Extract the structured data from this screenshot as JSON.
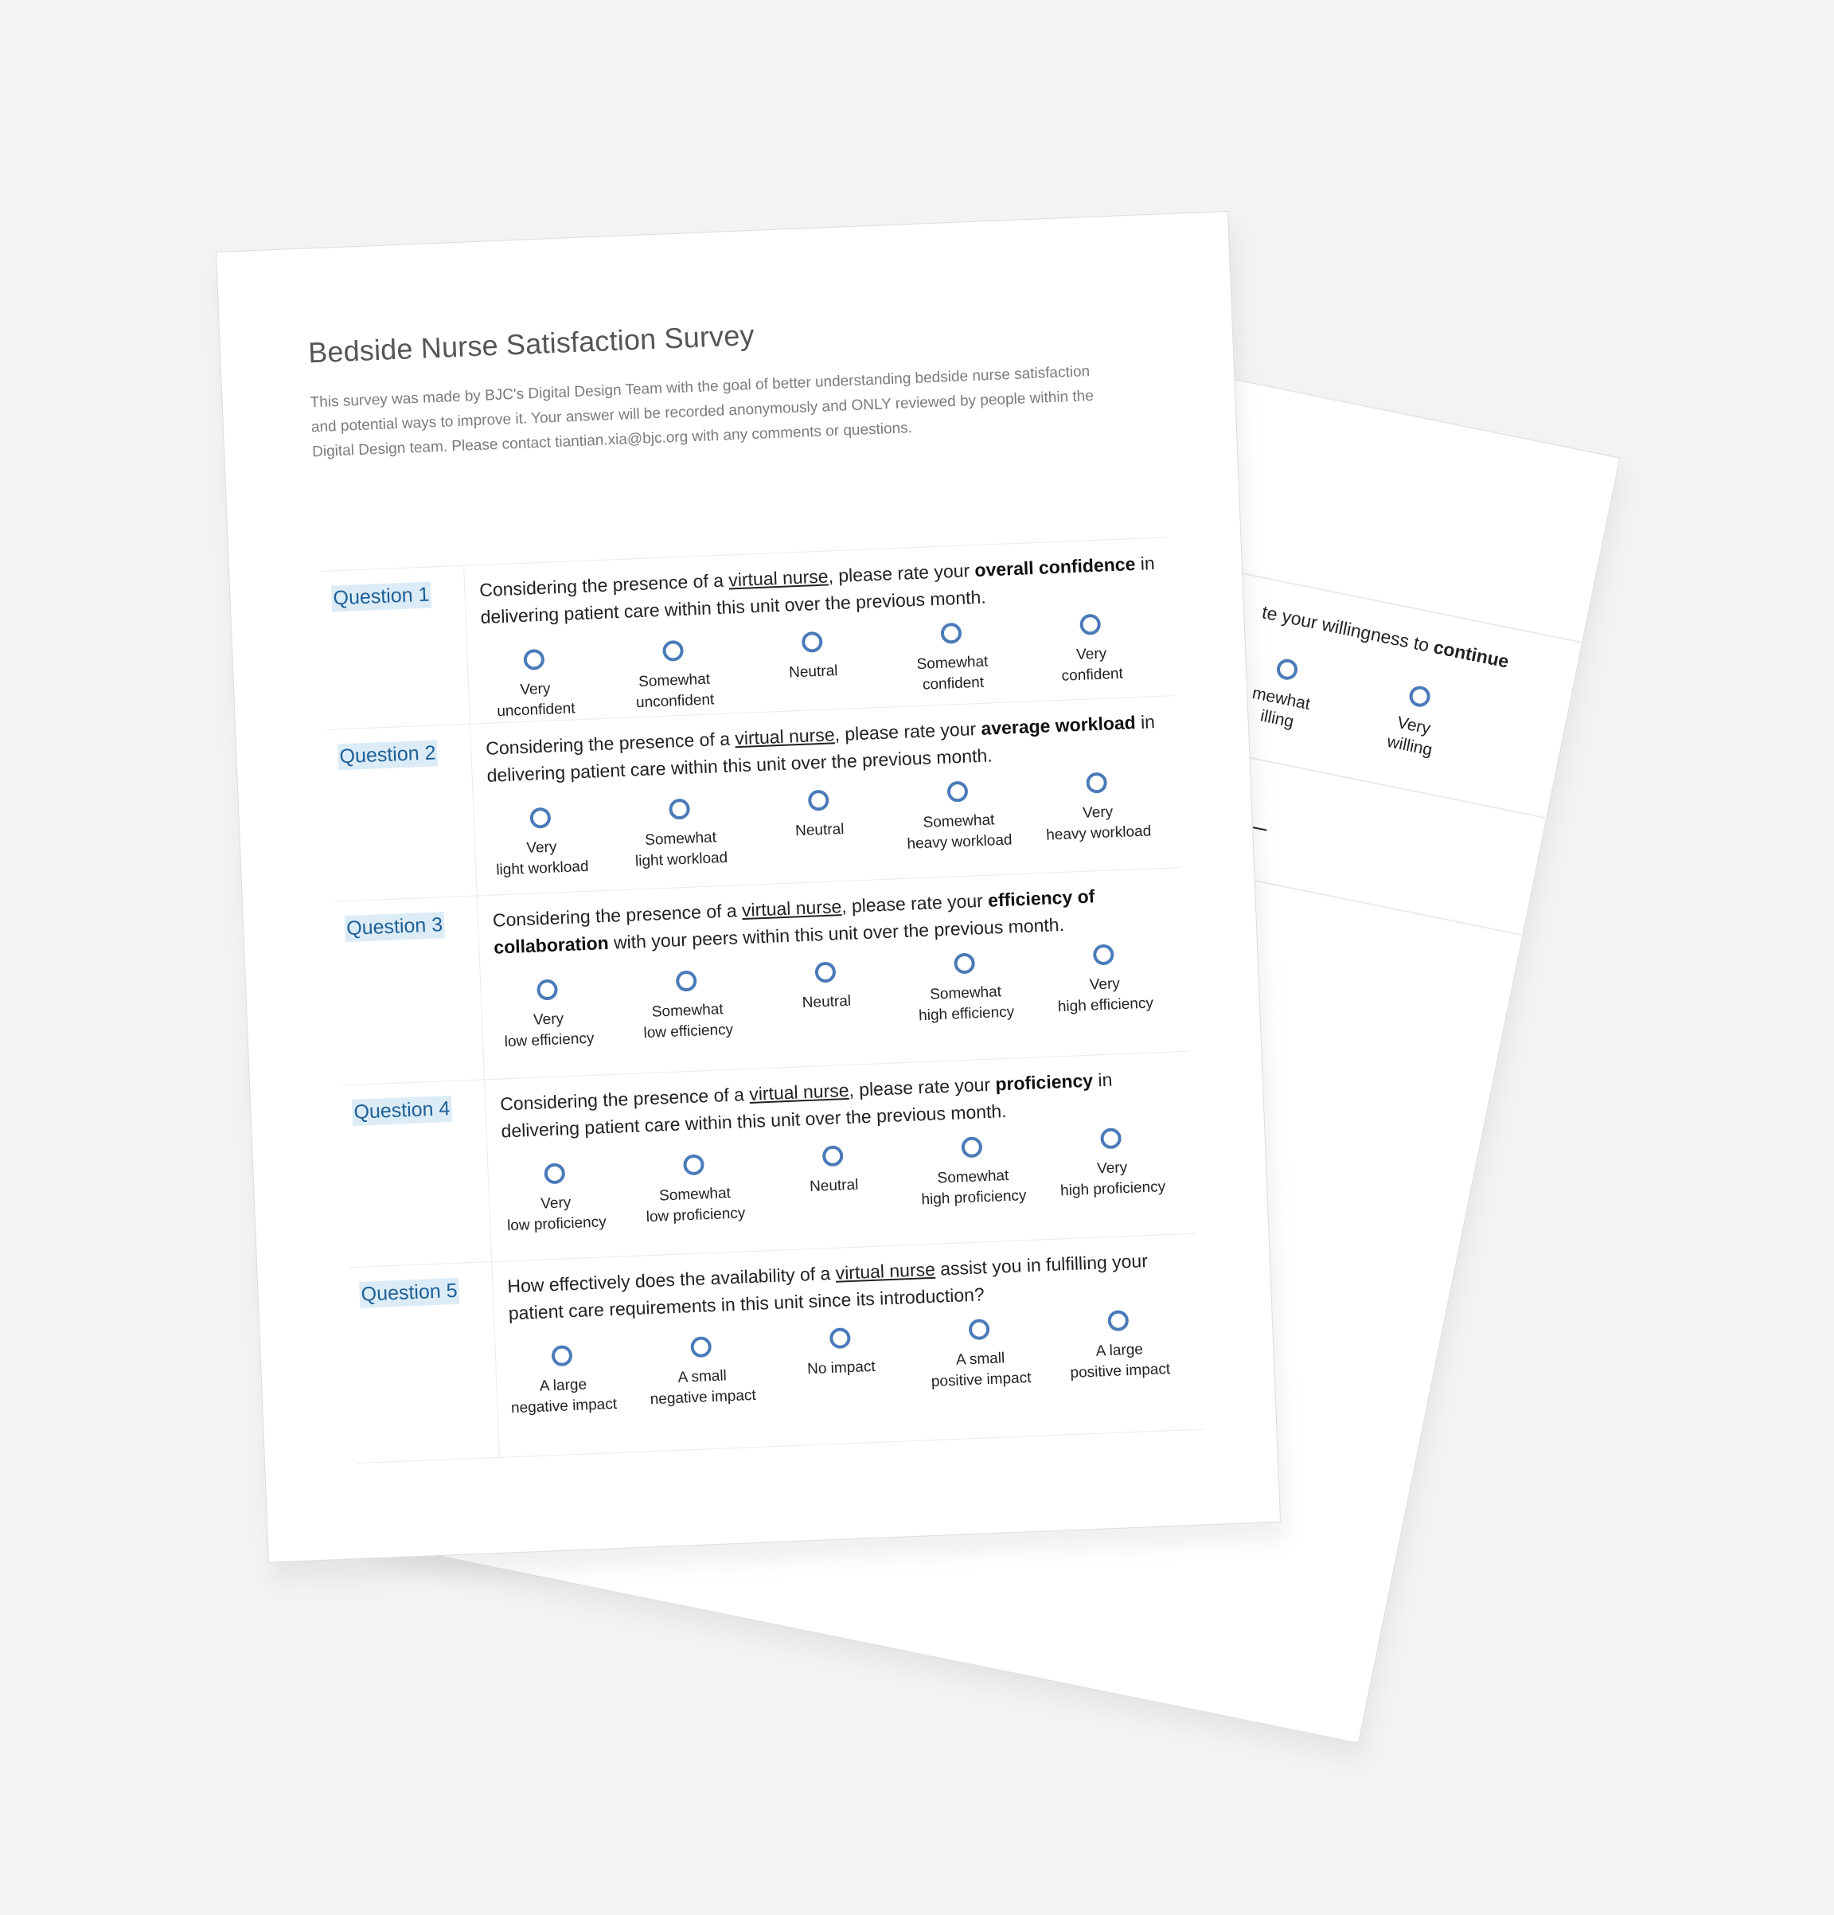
{
  "survey": {
    "title": "Bedside Nurse Satisfaction Survey",
    "description": "This survey was made by BJC's Digital Design Team with the goal of better understanding bedside nurse satisfaction and potential ways to improve it. Your answer will be recorded anonymously and ONLY reviewed by people within the Digital Design team. Please contact tiantian.xia@bjc.org with any comments or questions.",
    "accent_color": "#1d5f97",
    "label_highlight_color": "#dcecf7",
    "radio_color": "#4a7ab9"
  },
  "questions": [
    {
      "label": "Question 1",
      "text_before": "Considering the presence of a ",
      "underlined": "virtual nurse",
      "text_middle": ", please rate your ",
      "bold": "overall confidence",
      "text_after": " in delivering patient care within this unit over the previous month.",
      "options": [
        "Very\nunconfident",
        "Somewhat\nunconfident",
        "Neutral",
        "Somewhat\nconfident",
        "Very\nconfident"
      ]
    },
    {
      "label": "Question 2",
      "text_before": "Considering the presence of a ",
      "underlined": "virtual nurse",
      "text_middle": ", please rate your ",
      "bold": "average workload",
      "text_after": " in delivering patient care within this unit over the previous month.",
      "options": [
        "Very\nlight workload",
        "Somewhat\nlight workload",
        "Neutral",
        "Somewhat\nheavy workload",
        "Very\nheavy workload"
      ]
    },
    {
      "label": "Question 3",
      "text_before": "Considering the presence of a ",
      "underlined": "virtual nurse",
      "text_middle": ", please rate your ",
      "bold": "efficiency of collaboration",
      "text_after": " with your peers within this unit over the previous month.",
      "options": [
        "Very\nlow efficiency",
        "Somewhat\nlow efficiency",
        "Neutral",
        "Somewhat\nhigh efficiency",
        "Very\nhigh efficiency"
      ]
    },
    {
      "label": "Question 4",
      "text_before": "Considering the presence of a ",
      "underlined": "virtual nurse",
      "text_middle": ", please rate your ",
      "bold": "proficiency",
      "text_after": " in delivering patient care within this unit over the previous month.",
      "options": [
        "Very\nlow proficiency",
        "Somewhat\nlow proficiency",
        "Neutral",
        "Somewhat\nhigh proficiency",
        "Very\nhigh proficiency"
      ]
    },
    {
      "label": "Question 5",
      "text_before": "How effectively does the availability of a ",
      "underlined": "virtual nurse",
      "text_middle": " assist you in fulfilling your patient care requirements in this unit since its introduction?",
      "bold": "",
      "text_after": "",
      "options": [
        "A large\nnegative impact",
        "A small\nnegative impact",
        "No impact",
        "A small\npositive impact",
        "A large\npositive impact"
      ]
    }
  ],
  "back_page": {
    "partial_question_text": "te your willingness to ",
    "partial_question_bold": "continue",
    "options": [
      "mewhat\nilling",
      "Very\nwilling"
    ]
  }
}
